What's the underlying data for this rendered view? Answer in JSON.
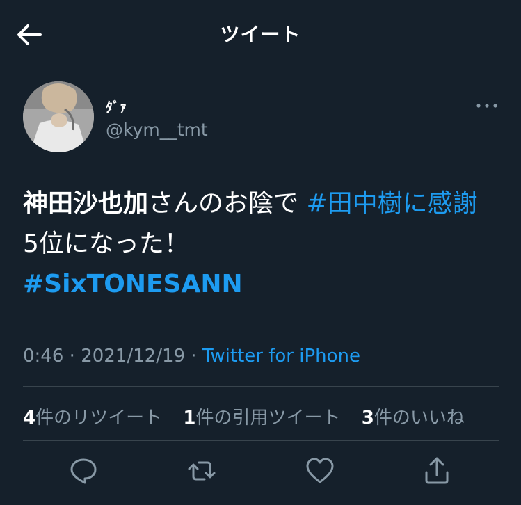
{
  "header": {
    "title": "ツイート"
  },
  "user": {
    "display_name": "ﾀﾞｧ",
    "handle": "@kym__tmt"
  },
  "tweet": {
    "text_bold": "神田沙也加",
    "text_1": "さんのお陰で ",
    "hashtag_1": "#田中樹に感謝",
    "text_2": " 5位になった！",
    "hashtag_2": "#SixTONESANN"
  },
  "meta": {
    "time": "0:46",
    "separator": " · ",
    "date": "2021/12/19",
    "source": "Twitter for iPhone"
  },
  "stats": {
    "retweets_count": "4",
    "retweets_label": "件のリツイート",
    "quotes_count": "1",
    "quotes_label": "件の引用ツイート",
    "likes_count": "3",
    "likes_label": "件のいいね"
  },
  "icons": {
    "back": "arrow-left-icon",
    "more": "more-dots-icon",
    "reply": "reply-icon",
    "retweet": "retweet-icon",
    "like": "heart-icon",
    "share": "share-icon"
  },
  "colors": {
    "background": "#15202b",
    "accent": "#1d9bf0",
    "secondary_text": "#8899a6",
    "divider": "#38444d"
  }
}
